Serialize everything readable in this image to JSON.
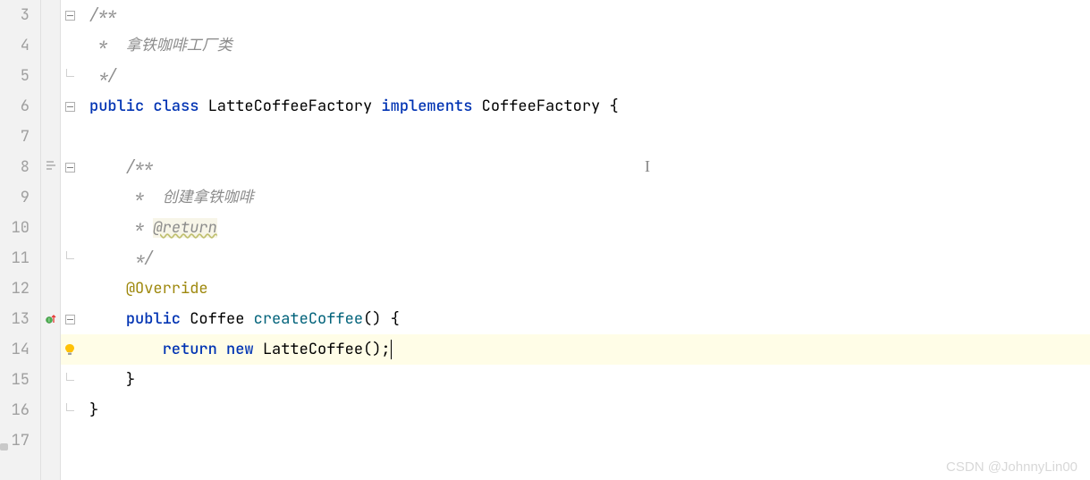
{
  "gutter": {
    "lines": [
      "3",
      "4",
      "5",
      "6",
      "7",
      "8",
      "9",
      "10",
      "11",
      "12",
      "13",
      "14",
      "15",
      "16",
      "17"
    ]
  },
  "code": {
    "l3": {
      "c1": "/**"
    },
    "l4": {
      "c1": " *  拿铁咖啡工厂类"
    },
    "l5": {
      "c1": " */"
    },
    "l6": {
      "k1": "public",
      "k2": "class",
      "t1": "LatteCoffeeFactory",
      "k3": "implements",
      "t2": "CoffeeFactory",
      "b1": "{"
    },
    "l7": {},
    "l8": {
      "c1": "/**"
    },
    "l9": {
      "c1": " *  创建拿铁咖啡"
    },
    "l10": {
      "c1": " * ",
      "tag": "@return"
    },
    "l11": {
      "c1": " */"
    },
    "l12": {
      "ann": "@Override"
    },
    "l13": {
      "k1": "public",
      "t1": "Coffee",
      "m1": "createCoffee",
      "p": "()",
      "b1": "{"
    },
    "l14": {
      "k1": "return",
      "k2": "new",
      "t1": "LatteCoffee",
      "p": "();"
    },
    "l15": {
      "b1": "}"
    },
    "l16": {
      "b1": "}"
    }
  },
  "watermark": "CSDN @JohnnyLin00"
}
